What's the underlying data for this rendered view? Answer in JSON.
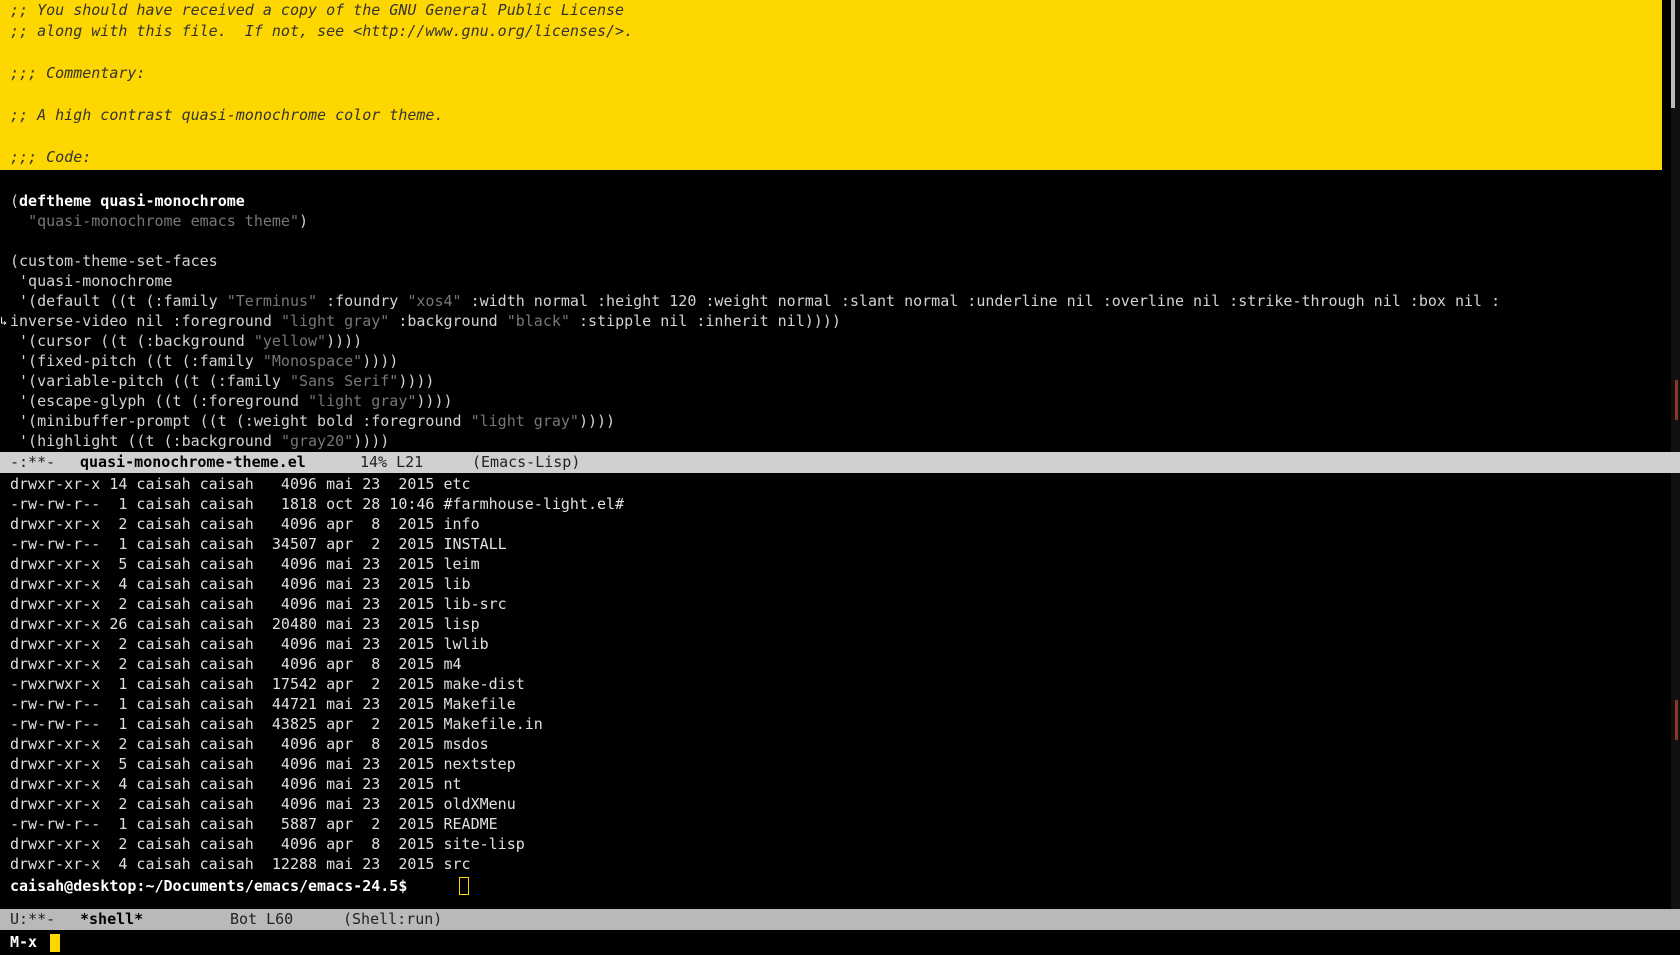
{
  "editor": {
    "comment_lines": [
      ";; You should have received a copy of the GNU General Public License",
      ";; along with this file.  If not, see <http://www.gnu.org/licenses/>.",
      "",
      ";;; Commentary:",
      "",
      ";; A high contrast quasi-monochrome color theme.",
      "",
      ";;; Code:"
    ],
    "code": {
      "deftheme_kw": "deftheme quasi-monochrome",
      "deftheme_str": "\"quasi-monochrome emacs theme\"",
      "custom_set": "(custom-theme-set-faces",
      "theme_quote": " 'quasi-monochrome",
      "default_1a": " '(default ((t (:family ",
      "default_1b": "\"Terminus\"",
      "default_1c": " :foundry ",
      "default_1d": "\"xos4\"",
      "default_1e": " :width normal :height 120 :weight normal :slant normal :underline nil :overline nil :strike-through nil :box nil :",
      "default_2a": "inverse-video nil :foreground ",
      "default_2b": "\"light gray\"",
      "default_2c": " :background ",
      "default_2d": "\"black\"",
      "default_2e": " :stipple nil :inherit nil))))",
      "cursor_a": " '(cursor ((t (:background ",
      "cursor_b": "\"yellow\"",
      "cursor_c": "))))",
      "fixed_a": " '(fixed-pitch ((t (:family ",
      "fixed_b": "\"Monospace\"",
      "fixed_c": "))))",
      "variable_a": " '(variable-pitch ((t (:family ",
      "variable_b": "\"Sans Serif\"",
      "variable_c": "))))",
      "escape_a": " '(escape-glyph ((t (:foreground ",
      "escape_b": "\"light gray\"",
      "escape_c": "))))",
      "minibuf_a": " '(minibuffer-prompt ((t (:weight bold :foreground ",
      "minibuf_b": "\"light gray\"",
      "minibuf_c": "))))",
      "highlight_a": " '(highlight ((t (:background ",
      "highlight_b": "\"gray20\"",
      "highlight_c": "))))"
    }
  },
  "modeline_top": {
    "status": "-:**-",
    "buffer": "quasi-monochrome-theme.el",
    "position": "14% L21",
    "mode": "(Emacs-Lisp)"
  },
  "shell": {
    "lines": [
      "drwxr-xr-x 14 caisah caisah   4096 mai 23  2015 etc",
      "-rw-rw-r--  1 caisah caisah   1818 oct 28 10:46 #farmhouse-light.el#",
      "drwxr-xr-x  2 caisah caisah   4096 apr  8  2015 info",
      "-rw-rw-r--  1 caisah caisah  34507 apr  2  2015 INSTALL",
      "drwxr-xr-x  5 caisah caisah   4096 mai 23  2015 leim",
      "drwxr-xr-x  4 caisah caisah   4096 mai 23  2015 lib",
      "drwxr-xr-x  2 caisah caisah   4096 mai 23  2015 lib-src",
      "drwxr-xr-x 26 caisah caisah  20480 mai 23  2015 lisp",
      "drwxr-xr-x  2 caisah caisah   4096 mai 23  2015 lwlib",
      "drwxr-xr-x  2 caisah caisah   4096 apr  8  2015 m4",
      "-rwxrwxr-x  1 caisah caisah  17542 apr  2  2015 make-dist",
      "-rw-rw-r--  1 caisah caisah  44721 mai 23  2015 Makefile",
      "-rw-rw-r--  1 caisah caisah  43825 apr  2  2015 Makefile.in",
      "drwxr-xr-x  2 caisah caisah   4096 apr  8  2015 msdos",
      "drwxr-xr-x  5 caisah caisah   4096 mai 23  2015 nextstep",
      "drwxr-xr-x  4 caisah caisah   4096 mai 23  2015 nt",
      "drwxr-xr-x  2 caisah caisah   4096 mai 23  2015 oldXMenu",
      "-rw-rw-r--  1 caisah caisah   5887 apr  2  2015 README",
      "drwxr-xr-x  2 caisah caisah   4096 apr  8  2015 site-lisp",
      "drwxr-xr-x  4 caisah caisah  12288 mai 23  2015 src"
    ],
    "prompt": "caisah@desktop:~/Documents/emacs/emacs-24.5$ "
  },
  "modeline_bot": {
    "status": "U:**-",
    "buffer": "*shell*",
    "position": "Bot L60",
    "mode": "(Shell:run)"
  },
  "minibuffer": {
    "prompt": "M-x"
  },
  "colors": {
    "comment_bg": "#FFD700",
    "background": "#000000",
    "foreground": "#D3D3D3",
    "string": "#777777",
    "cursor": "#FFD700"
  }
}
